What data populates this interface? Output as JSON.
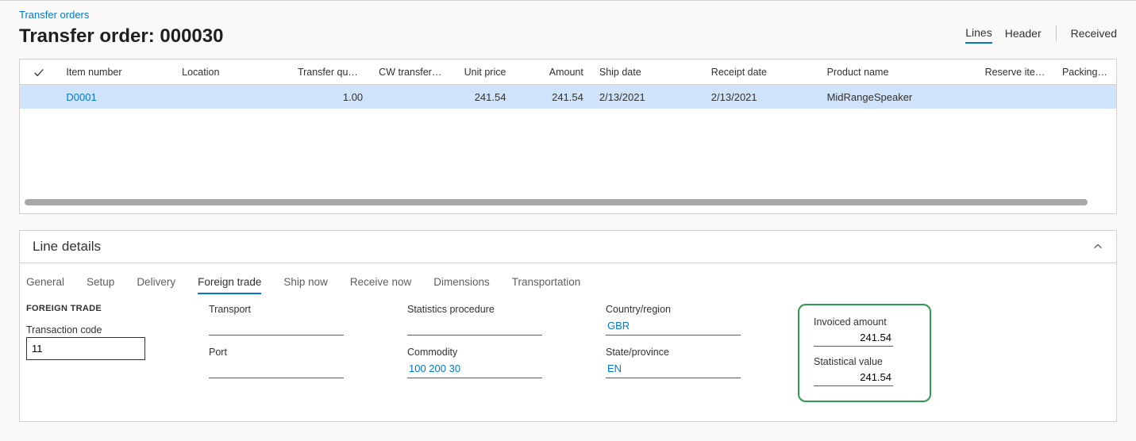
{
  "breadcrumb": "Transfer orders",
  "title": "Transfer order: 000030",
  "headerTabs": {
    "lines": "Lines",
    "header": "Header",
    "received": "Received"
  },
  "grid": {
    "columns": {
      "item": "Item number",
      "location": "Location",
      "transferQty": "Transfer quantity",
      "cwQty": "CW transfer qty",
      "unitPrice": "Unit price",
      "amount": "Amount",
      "shipDate": "Ship date",
      "receiptDate": "Receipt date",
      "productName": "Product name",
      "reserve": "Reserve items a...",
      "packing": "Packing qu"
    },
    "rows": [
      {
        "item": "D0001",
        "location": "",
        "transferQty": "1.00",
        "cwQty": "",
        "unitPrice": "241.54",
        "amount": "241.54",
        "shipDate": "2/13/2021",
        "receiptDate": "2/13/2021",
        "productName": "MidRangeSpeaker",
        "reserve": "",
        "packing": ""
      }
    ]
  },
  "lineDetails": {
    "title": "Line details",
    "tabs": {
      "general": "General",
      "setup": "Setup",
      "delivery": "Delivery",
      "foreignTrade": "Foreign trade",
      "shipNow": "Ship now",
      "receiveNow": "Receive now",
      "dimensions": "Dimensions",
      "transportation": "Transportation"
    },
    "section": "FOREIGN TRADE",
    "fields": {
      "transactionCode": {
        "label": "Transaction code",
        "value": "11"
      },
      "transport": {
        "label": "Transport",
        "value": ""
      },
      "port": {
        "label": "Port",
        "value": ""
      },
      "statsProcedure": {
        "label": "Statistics procedure",
        "value": ""
      },
      "commodity": {
        "label": "Commodity",
        "value": "100 200 30"
      },
      "countryRegion": {
        "label": "Country/region",
        "value": "GBR"
      },
      "stateProvince": {
        "label": "State/province",
        "value": "EN"
      },
      "invoicedAmount": {
        "label": "Invoiced amount",
        "value": "241.54"
      },
      "statisticalValue": {
        "label": "Statistical value",
        "value": "241.54"
      }
    }
  }
}
